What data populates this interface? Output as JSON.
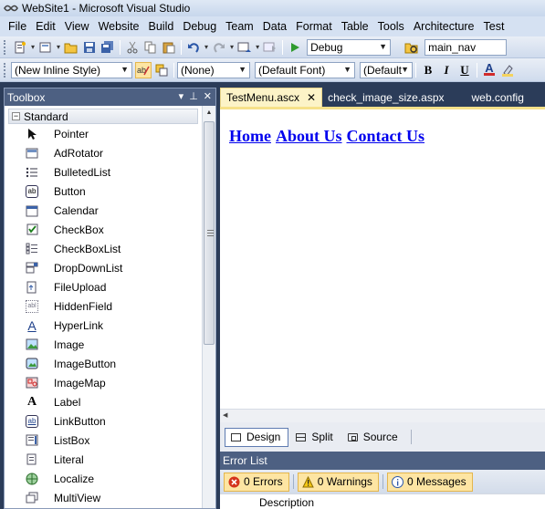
{
  "window": {
    "title": "WebSite1 - Microsoft Visual Studio"
  },
  "menubar": {
    "items": [
      "File",
      "Edit",
      "View",
      "Website",
      "Build",
      "Debug",
      "Team",
      "Data",
      "Format",
      "Table",
      "Tools",
      "Architecture",
      "Test"
    ]
  },
  "toolbar1": {
    "config": "Debug",
    "find": "main_nav"
  },
  "toolbar2": {
    "style": "(New Inline Style)",
    "block": "(None)",
    "font": "(Default Font)",
    "size": "(Default",
    "bold": "B",
    "italic": "I",
    "underline": "U",
    "font_color_glyph": "A"
  },
  "toolbox": {
    "title": "Toolbox",
    "section": "Standard",
    "items": [
      {
        "label": "Pointer",
        "icon": "pointer-icon"
      },
      {
        "label": "AdRotator",
        "icon": "adrotator-icon"
      },
      {
        "label": "BulletedList",
        "icon": "bulleted-list-icon"
      },
      {
        "label": "Button",
        "icon": "button-icon",
        "glyph": "ab"
      },
      {
        "label": "Calendar",
        "icon": "calendar-icon"
      },
      {
        "label": "CheckBox",
        "icon": "checkbox-icon"
      },
      {
        "label": "CheckBoxList",
        "icon": "checkbox-list-icon"
      },
      {
        "label": "DropDownList",
        "icon": "dropdown-list-icon"
      },
      {
        "label": "FileUpload",
        "icon": "file-upload-icon"
      },
      {
        "label": "HiddenField",
        "icon": "hidden-field-icon",
        "glyph": "abl"
      },
      {
        "label": "HyperLink",
        "icon": "hyperlink-icon",
        "glyph": "A"
      },
      {
        "label": "Image",
        "icon": "image-icon"
      },
      {
        "label": "ImageButton",
        "icon": "image-button-icon"
      },
      {
        "label": "ImageMap",
        "icon": "image-map-icon"
      },
      {
        "label": "Label",
        "icon": "label-icon",
        "glyph": "A"
      },
      {
        "label": "LinkButton",
        "icon": "link-button-icon",
        "glyph": "ab"
      },
      {
        "label": "ListBox",
        "icon": "listbox-icon"
      },
      {
        "label": "Literal",
        "icon": "literal-icon"
      },
      {
        "label": "Localize",
        "icon": "localize-icon"
      },
      {
        "label": "MultiView",
        "icon": "multiview-icon"
      }
    ]
  },
  "tabs": [
    {
      "label": "TestMenu.ascx",
      "active": true
    },
    {
      "label": "check_image_size.aspx",
      "active": false
    },
    {
      "label": "web.config",
      "active": false
    }
  ],
  "design": {
    "links": [
      "Home",
      "About Us",
      "Contact Us"
    ]
  },
  "views": {
    "design": "Design",
    "split": "Split",
    "source": "Source"
  },
  "errorlist": {
    "title": "Error List",
    "errors": "0 Errors",
    "warnings": "0 Warnings",
    "messages": "0 Messages",
    "column_description": "Description"
  },
  "colors": {
    "panel_header": "#4d6082",
    "active_tab": "#fcf3c7",
    "link": "#0000ee",
    "background": "#2b3c59"
  }
}
